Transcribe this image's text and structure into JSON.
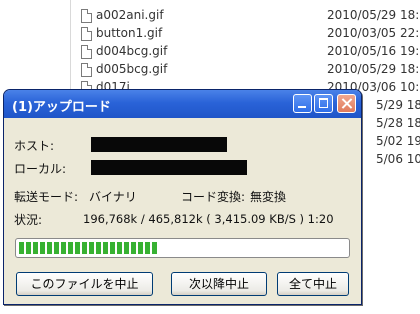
{
  "file_list": [
    {
      "name": "a002ani.gif",
      "date": "2010/05/29 18:32"
    },
    {
      "name": "button1.gif",
      "date": "2010/03/05 22:16"
    },
    {
      "name": "d004bcg.gif",
      "date": "2010/05/16 19:33"
    },
    {
      "name": "d005bcg.gif",
      "date": "2010/05/29 18:32"
    },
    {
      "name": "d017i...",
      "date": "2010/03/06 10:27"
    },
    {
      "name": "",
      "date": "5/29 18:32"
    },
    {
      "name": "",
      "date": "5/28 18:18"
    },
    {
      "name": "",
      "date": "5/02 19:56"
    },
    {
      "name": "",
      "date": "5/06 10:15"
    }
  ],
  "dialog": {
    "title": "(1)アップロード",
    "host_label": "ホスト:",
    "local_label": "ローカル:",
    "transfer_mode_label": "転送モード:",
    "transfer_mode_value": "バイナリ",
    "code_convert_label": "コード変換:",
    "code_convert_value": "無変換",
    "status_label": "状況:",
    "status_value": "196,768k / 465,812k ( 3,415.09 KB/S ) 1:20",
    "progress": 0.42,
    "buttons": {
      "cancel_file": "このファイルを中止",
      "cancel_next": "次以降中止",
      "cancel_all": "全て中止"
    }
  }
}
